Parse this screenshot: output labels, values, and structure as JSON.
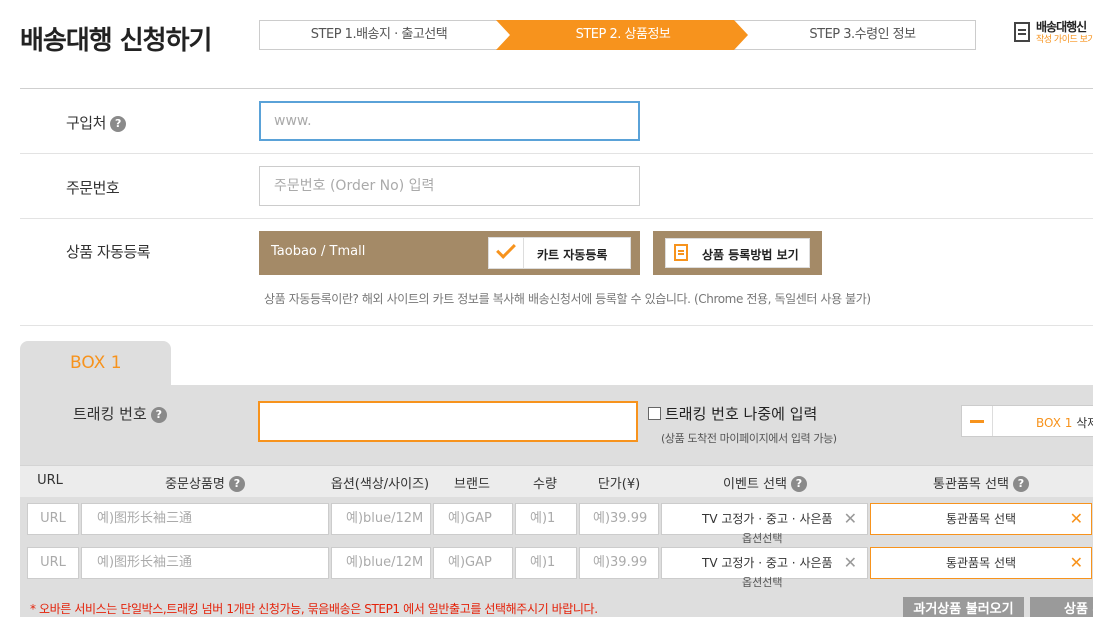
{
  "page": {
    "title": "배송대행 신청하기"
  },
  "steps": [
    {
      "label": "STEP 1.배송지 · 출고선택"
    },
    {
      "label": "STEP 2. 상품정보"
    },
    {
      "label": "STEP 3.수령인 정보"
    }
  ],
  "guide": {
    "title": "배송대행신",
    "subtitle": "작성 가이드 보기"
  },
  "form": {
    "purchase": {
      "label": "구입처",
      "placeholder": "www."
    },
    "order": {
      "label": "주문번호",
      "placeholder": "주문번호 (Order No) 입력"
    },
    "auto": {
      "label": "상품 자동등록",
      "source": "Taobao / Tmall",
      "cart_button": "카트 자동등록",
      "howto_button": "상품 등록방법 보기",
      "note": "상품 자동등록이란? 해외 사이트의 카트 정보를 복사해 배송신청서에 등록할 수 있습니다. (Chrome 전용, 독일센터 사용 불가)"
    }
  },
  "box": {
    "tab_label": "BOX 1",
    "tracking_label": "트래킹 번호",
    "later_label": "트래킹 번호 나중에 입력",
    "later_note": "(상품 도착전 마이페이지에서 입력 가능)",
    "delete_box": "BOX 1",
    "delete_suffix": "삭제"
  },
  "table": {
    "headers": [
      "URL",
      "중문상품명",
      "옵션(색상/사이즈)",
      "브랜드",
      "수량",
      "단가(¥)",
      "이벤트 선택",
      "통관품목 선택"
    ],
    "rows": [
      {
        "url": "URL",
        "name": "예)图形长袖三通",
        "option": "예)blue/12M",
        "brand": "예)GAP",
        "qty": "예)1",
        "price": "예)39.99",
        "event": "TV 고정가 · 중고 · 사은품",
        "event_sub": "옵션선택",
        "customs": "통관품목 선택"
      },
      {
        "url": "URL",
        "name": "예)图形长袖三通",
        "option": "예)blue/12M",
        "brand": "예)GAP",
        "qty": "예)1",
        "price": "예)39.99",
        "event": "TV 고정가 · 중고 · 사은품",
        "event_sub": "옵션선택",
        "customs": "통관품목 선택"
      }
    ]
  },
  "footer": {
    "note": "* 오바른 서비스는 단일박스,트래킹 넘버 1개만 신청가능, 묶음배송은 STEP1 에서 일반출고를 선택해주시기 바랍니다.",
    "past_button": "과거상품 불러오기",
    "add_button": "상품 추가"
  },
  "colors": {
    "accent": "#f7931d",
    "brown": "#a48a67",
    "box_bg": "#dedede",
    "warning": "#e4220a"
  }
}
